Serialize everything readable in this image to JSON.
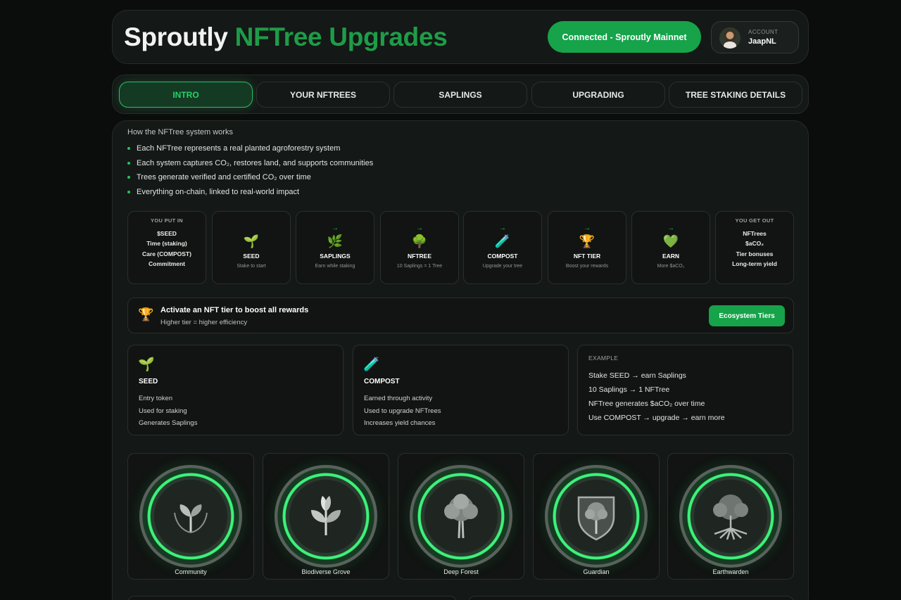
{
  "header": {
    "title_part1": "Sproutly",
    "title_part2": "NFTree Upgrades",
    "connection_label": "Connected - Sproutly Mainnet",
    "account_label": "ACCOUNT",
    "account_name": "JaapNL"
  },
  "tabs": [
    {
      "label": "INTRO",
      "active": true
    },
    {
      "label": "YOUR NFTREES",
      "active": false
    },
    {
      "label": "SAPLINGS",
      "active": false
    },
    {
      "label": "UPGRADING",
      "active": false
    },
    {
      "label": "TREE STAKING DETAILS",
      "active": false
    }
  ],
  "intro": {
    "heading": "How the NFTree system works",
    "bullets": [
      "Each NFTree represents a real planted agroforestry system",
      "Each system captures CO₂, restores land, and supports communities",
      "Trees generate verified and certified CO₂ over time",
      "Everything on-chain, linked to real-world impact"
    ]
  },
  "flow": {
    "put_in": {
      "title": "YOU PUT IN",
      "lines": [
        "$SEED",
        "Time (staking)",
        "Care (COMPOST)",
        "Commitment"
      ]
    },
    "steps": [
      {
        "arrow": "",
        "icon": "🌱",
        "icon_name": "seedling-icon",
        "name": "SEED",
        "sub": "Stake to start"
      },
      {
        "arrow": "→",
        "icon": "🌿",
        "icon_name": "herb-icon",
        "name": "SAPLINGS",
        "sub": "Earn while staking"
      },
      {
        "arrow": "→",
        "icon": "🌳",
        "icon_name": "tree-icon",
        "name": "NFTREE",
        "sub": "10 Saplings = 1 Tree"
      },
      {
        "arrow": "→",
        "icon": "🧪",
        "icon_name": "test-tube-icon",
        "name": "COMPOST",
        "sub": "Upgrade your tree"
      },
      {
        "arrow": "→",
        "icon": "🏆",
        "icon_name": "trophy-icon",
        "name": "NFT TIER",
        "sub": "Boost your rewards"
      },
      {
        "arrow": "→",
        "icon": "💚",
        "icon_name": "green-heart-icon",
        "name": "EARN",
        "sub": "More $aCO₂"
      }
    ],
    "get_out": {
      "title": "YOU GET OUT",
      "lines": [
        "NFTrees",
        "$aCO₂",
        "Tier bonuses",
        "Long-term yield"
      ]
    }
  },
  "tier_banner": {
    "icon": "🏆",
    "title": "Activate an NFT tier to boost all rewards",
    "subtitle": "Higher tier = higher efficiency",
    "button_label": "Ecosystem Tiers"
  },
  "token_cards": [
    {
      "icon": "🌱",
      "title": "SEED",
      "lines": [
        "Entry token",
        "Used for staking",
        "Generates Saplings"
      ]
    },
    {
      "icon": "🧪",
      "title": "COMPOST",
      "lines": [
        "Earned through activity",
        "Used to upgrade NFTrees",
        "Increases yield chances"
      ]
    }
  ],
  "example": {
    "title": "EXAMPLE",
    "lines": [
      "Stake SEED → earn Saplings",
      "10 Saplings → 1 NFTree",
      "NFTree generates $aCO₂ over time",
      "Use COMPOST → upgrade → earn more"
    ]
  },
  "tiers": [
    {
      "name": "Community",
      "emblem": "sprout-emblem"
    },
    {
      "name": "Biodiverse Grove",
      "emblem": "leaf-emblem"
    },
    {
      "name": "Deep Forest",
      "emblem": "tree-emblem"
    },
    {
      "name": "Guardian",
      "emblem": "shield-tree-emblem"
    },
    {
      "name": "Earthwarden",
      "emblem": "roots-tree-emblem"
    }
  ],
  "colors": {
    "accent": "#16a34a",
    "title_green": "#1e9c48",
    "background": "#0b0d0c",
    "panel": "#141816"
  }
}
